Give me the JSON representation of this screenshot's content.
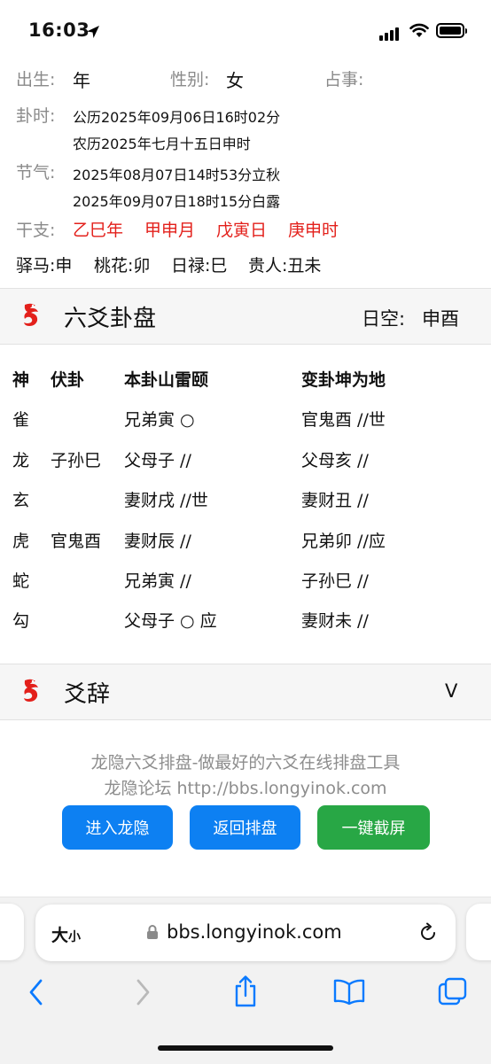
{
  "status": {
    "time": "16:03"
  },
  "info": {
    "birth_label": "出生:",
    "birth_value": "年",
    "gender_label": "性别:",
    "gender_value": "女",
    "matter_label": "占事:",
    "gua_time_label": "卦时:",
    "gua_time_solar": "公历2025年09月06日16时02分",
    "gua_time_lunar": "农历2025年七月十五日申时",
    "solar_term_label": "节气:",
    "solar_term_1": "2025年08月07日14时53分立秋",
    "solar_term_2": "2025年09月07日18时15分白露",
    "ganzhi_label": "干支:",
    "ganzhi": [
      "乙巳年",
      "甲申月",
      "戊寅日",
      "庚申时"
    ],
    "stars": [
      "驿马:申",
      "桃花:卯",
      "日禄:巳",
      "贵人:丑未"
    ]
  },
  "pan": {
    "title": "六爻卦盘",
    "kong_label": "日空:",
    "kong_value": "申酉",
    "headers": [
      "神",
      "伏卦",
      "本卦山雷颐",
      "变卦坤为地"
    ],
    "rows": [
      [
        "雀",
        "",
        "兄弟寅 ○",
        "官鬼酉 //世"
      ],
      [
        "龙",
        "子孙巳",
        "父母子 //",
        "父母亥 //"
      ],
      [
        "玄",
        "",
        "妻财戌 //世",
        "妻财丑 //"
      ],
      [
        "虎",
        "官鬼酉",
        "妻财辰 //",
        "兄弟卯 //应"
      ],
      [
        "蛇",
        "",
        "兄弟寅 //",
        "子孙巳 //"
      ],
      [
        "勾",
        "",
        "父母子 ○ 应",
        "妻财未 //"
      ]
    ]
  },
  "yaoci": {
    "title": "爻辞",
    "toggle": "V"
  },
  "footer": {
    "line1": "龙隐六爻排盘-做最好的六爻在线排盘工具",
    "line2": "龙隐论坛 http://bbs.longyinok.com",
    "buttons": [
      "进入龙隐",
      "返回排盘",
      "一键截屏"
    ]
  },
  "browser": {
    "text_size_big": "大",
    "text_size_small": "小",
    "url": "bbs.longyinok.com"
  }
}
